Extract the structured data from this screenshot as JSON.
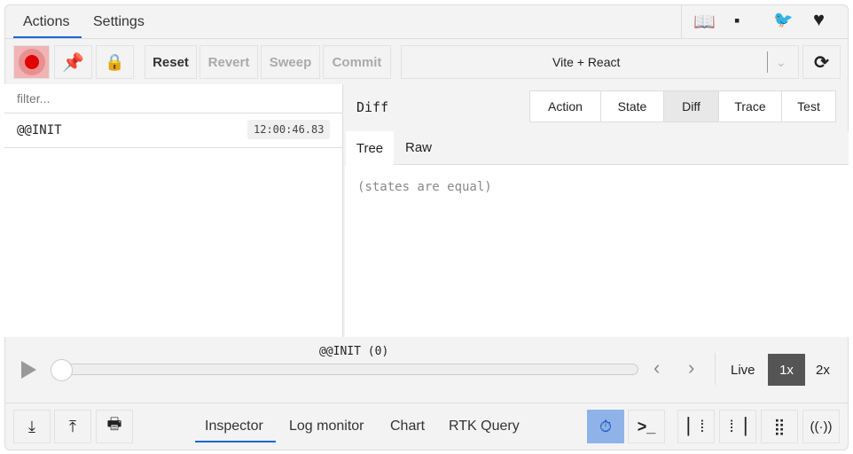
{
  "tabs": [
    {
      "label": "Actions",
      "active": true
    },
    {
      "label": "Settings"
    }
  ],
  "header_icons": [
    "book-icon",
    "chat-icon",
    "twitter-icon",
    "heart-icon"
  ],
  "toolbar": {
    "reset": "Reset",
    "revert": "Revert",
    "sweep": "Sweep",
    "commit": "Commit",
    "instance": "Vite + React"
  },
  "filter": {
    "placeholder": "filter..."
  },
  "actions": [
    {
      "name": "@@INIT",
      "time": "12:00:46.83"
    }
  ],
  "right": {
    "title": "Diff",
    "tabs": [
      "Action",
      "State",
      "Diff",
      "Trace",
      "Test"
    ],
    "active_tab": "Diff",
    "subtabs": [
      "Tree",
      "Raw"
    ],
    "active_subtab": "Tree",
    "content": "(states are equal)"
  },
  "slider": {
    "label": "@@INIT (0)",
    "position": 0,
    "live": "Live",
    "speed1": "1x",
    "speed2": "2x",
    "active_speed": "1x"
  },
  "monitors": [
    "Inspector",
    "Log monitor",
    "Chart",
    "RTK Query"
  ],
  "active_monitor": "Inspector",
  "colors": {
    "accent": "#1a66d0",
    "record": "#e00000"
  }
}
